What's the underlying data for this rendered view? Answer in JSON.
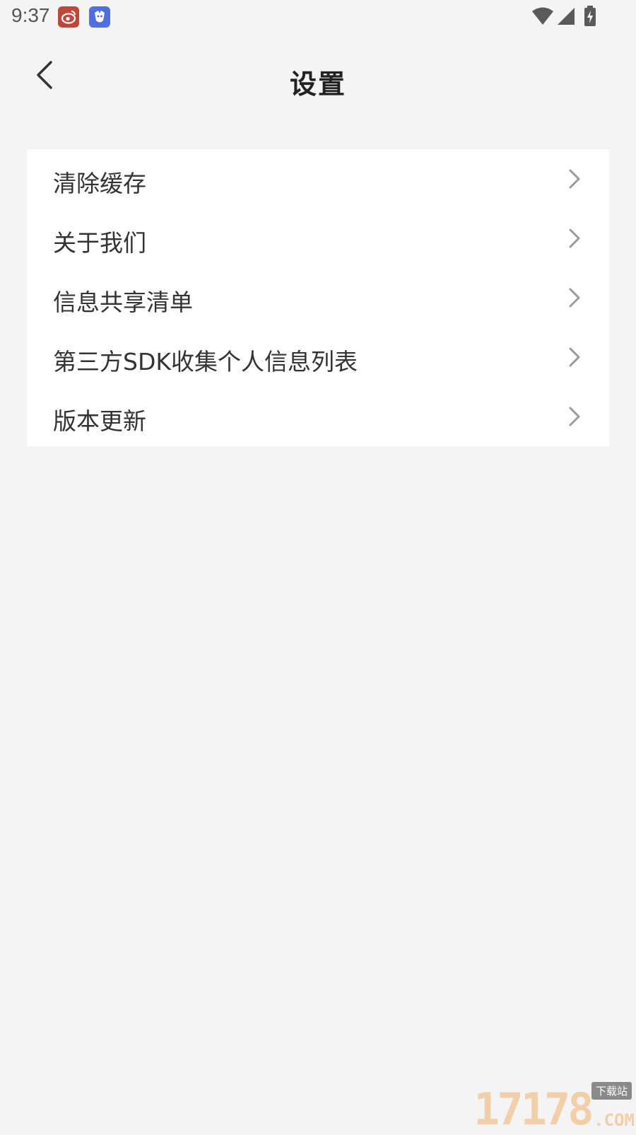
{
  "status_bar": {
    "time": "9:37",
    "notification_icons": [
      "weibo-icon",
      "app-notification-icon"
    ],
    "system_icons": [
      "wifi-icon",
      "signal-icon",
      "battery-charging-icon"
    ]
  },
  "header": {
    "title": "设置",
    "back_icon": "chevron-left-icon"
  },
  "menu": {
    "items": [
      {
        "label": "清除缓存"
      },
      {
        "label": "关于我们"
      },
      {
        "label": "信息共享清单"
      },
      {
        "label": "第三方SDK收集个人信息列表"
      },
      {
        "label": "版本更新"
      }
    ],
    "arrow_icon": "chevron-right-icon"
  },
  "watermark": {
    "digits": "17178",
    "tag": "下载站",
    "suffix": ".COM"
  },
  "colors": {
    "page_background": "#f4f4f5",
    "card_background": "#ffffff",
    "text": "#333333",
    "arrow": "#9a9a9a"
  }
}
